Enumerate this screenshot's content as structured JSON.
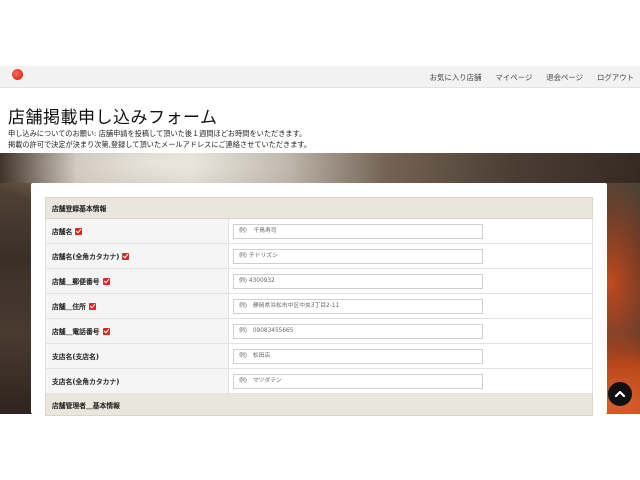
{
  "nav": {
    "items": [
      {
        "label": "お気に入り店舗"
      },
      {
        "label": "マイページ"
      },
      {
        "label": "退会ページ"
      },
      {
        "label": "ログアウト"
      }
    ]
  },
  "page": {
    "title": "店舗掲載申し込みフォーム",
    "intro_line1": "申し込みについてのお願い: 店舗申請を投稿して頂いた後１週間ほどお時間をいただきます。",
    "intro_line2": "掲載の許可で決定が決まり次第,登録して頂いたメールアドレスにご連絡させていただきます。"
  },
  "form": {
    "section1_title": "店舗登録基本情報",
    "section2_title": "店舗管理者＿基本情報",
    "rows": [
      {
        "label": "店舗名",
        "required": true,
        "placeholder": "例）　千鳥寿司"
      },
      {
        "label": "店舗名(全角カタカナ)",
        "required": true,
        "placeholder": "例) チドリズシ"
      },
      {
        "label": "店舗＿郵便番号",
        "required": true,
        "placeholder": "例) 4300932"
      },
      {
        "label": "店舗＿住所",
        "required": true,
        "placeholder": "例)　静岡県浜松市中区中央3丁目2-11"
      },
      {
        "label": "店舗＿電話番号",
        "required": true,
        "placeholder": "例)　09083455665"
      },
      {
        "label": "支店名(支店名)",
        "required": false,
        "placeholder": "例)　松田店"
      },
      {
        "label": "支店名(全角カタカナ)",
        "required": false,
        "placeholder": "例)　マツダテン"
      }
    ]
  },
  "colors": {
    "required_badge": "#e0242a",
    "section_bg": "#e9e6dd",
    "label_bg": "#f5f5f5"
  },
  "icons": {
    "logo": "red-circle-logo",
    "scroll_top": "chevron-up-icon"
  }
}
